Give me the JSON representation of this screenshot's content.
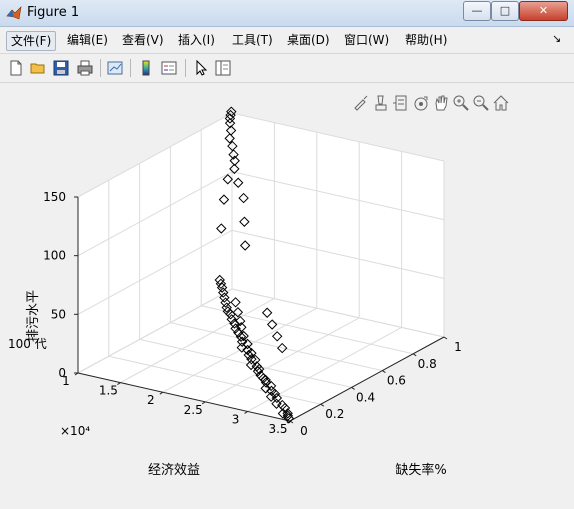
{
  "window": {
    "title": "Figure 1",
    "min_glyph": "—",
    "max_glyph": "□",
    "close_glyph": "✕"
  },
  "menu": {
    "items": [
      "文件(F)",
      "编辑(E)",
      "查看(V)",
      "插入(I)",
      "工具(T)",
      "桌面(D)",
      "窗口(W)",
      "帮助(H)"
    ],
    "corner_glyph": "↘"
  },
  "toolbar": {
    "icons": [
      "new-figure-icon",
      "open-file-icon",
      "save-icon",
      "print-icon",
      "link-plot-icon",
      "insert-colorbar-icon",
      "insert-legend-icon",
      "select-arrow-icon",
      "property-inspector-icon"
    ]
  },
  "axes_toolbar": {
    "icons": [
      "brush-icon",
      "data-tips-icon",
      "data-cursor-icon",
      "rotate-icon",
      "pan-icon",
      "zoom-in-icon",
      "zoom-out-icon",
      "home-icon"
    ]
  },
  "chart_data": {
    "type": "scatter3d",
    "marker": "diamond",
    "marker_color": "#000000",
    "xlabel": "经济效益",
    "ylabel": "缺失率%",
    "zlabel": "排污水平",
    "x_exponent_label": "×10⁴",
    "annotation": "100 代",
    "xlim": [
      1,
      3.5
    ],
    "ylim": [
      0,
      1
    ],
    "zlim": [
      0,
      150
    ],
    "x_ticks": [
      "1",
      "1.5",
      "2",
      "2.5",
      "3",
      "3.5"
    ],
    "y_ticks": [
      "0",
      "0.2",
      "0.4",
      "0.6",
      "0.8",
      "1"
    ],
    "z_ticks": [
      "0",
      "50",
      "100",
      "150"
    ],
    "grid": true,
    "points": [
      [
        3.45,
        0.02,
        0
      ],
      [
        3.42,
        0.03,
        1
      ],
      [
        3.4,
        0.04,
        2
      ],
      [
        3.38,
        0.02,
        3
      ],
      [
        3.35,
        0.05,
        5
      ],
      [
        3.3,
        0.06,
        6
      ],
      [
        3.25,
        0.05,
        7
      ],
      [
        3.2,
        0.08,
        9
      ],
      [
        3.15,
        0.07,
        10
      ],
      [
        3.1,
        0.1,
        12
      ],
      [
        3.05,
        0.09,
        14
      ],
      [
        3.0,
        0.12,
        16
      ],
      [
        2.95,
        0.13,
        18
      ],
      [
        2.9,
        0.14,
        19
      ],
      [
        2.85,
        0.15,
        21
      ],
      [
        2.8,
        0.17,
        23
      ],
      [
        2.75,
        0.16,
        24
      ],
      [
        2.7,
        0.19,
        26
      ],
      [
        2.65,
        0.2,
        28
      ],
      [
        2.6,
        0.22,
        30
      ],
      [
        2.55,
        0.21,
        32
      ],
      [
        2.5,
        0.24,
        34
      ],
      [
        2.45,
        0.26,
        36
      ],
      [
        2.4,
        0.27,
        38
      ],
      [
        2.35,
        0.28,
        40
      ],
      [
        2.3,
        0.3,
        42
      ],
      [
        2.25,
        0.31,
        44
      ],
      [
        2.2,
        0.33,
        46
      ],
      [
        2.15,
        0.34,
        47
      ],
      [
        2.1,
        0.36,
        48
      ],
      [
        2.05,
        0.38,
        50
      ],
      [
        2.0,
        0.4,
        52
      ],
      [
        1.95,
        0.42,
        54
      ],
      [
        1.9,
        0.44,
        56
      ],
      [
        1.85,
        0.46,
        57
      ],
      [
        1.8,
        0.48,
        58
      ],
      [
        3.05,
        0.15,
        5
      ],
      [
        2.95,
        0.18,
        8
      ],
      [
        2.85,
        0.2,
        10
      ],
      [
        2.7,
        0.24,
        14
      ],
      [
        2.6,
        0.27,
        18
      ],
      [
        2.5,
        0.3,
        20
      ],
      [
        2.4,
        0.33,
        24
      ],
      [
        2.3,
        0.36,
        27
      ],
      [
        2.2,
        0.4,
        30
      ],
      [
        2.15,
        0.42,
        33
      ],
      [
        2.05,
        0.46,
        36
      ],
      [
        1.95,
        0.5,
        40
      ],
      [
        2.5,
        0.5,
        10
      ],
      [
        2.35,
        0.55,
        14
      ],
      [
        2.2,
        0.6,
        18
      ],
      [
        2.05,
        0.65,
        22
      ],
      [
        1.7,
        0.7,
        70
      ],
      [
        1.6,
        0.75,
        85
      ],
      [
        1.5,
        0.8,
        100
      ],
      [
        1.4,
        0.82,
        110
      ],
      [
        1.3,
        0.85,
        118
      ],
      [
        1.25,
        0.88,
        122
      ],
      [
        1.2,
        0.9,
        125
      ],
      [
        1.15,
        0.92,
        130
      ],
      [
        1.1,
        0.93,
        135
      ],
      [
        1.08,
        0.95,
        140
      ],
      [
        1.05,
        0.96,
        145
      ],
      [
        1.03,
        0.97,
        148
      ],
      [
        1.02,
        0.98,
        150
      ],
      [
        1.01,
        0.99,
        152
      ],
      [
        1.6,
        0.6,
        90
      ],
      [
        1.45,
        0.7,
        105
      ],
      [
        1.35,
        0.78,
        115
      ]
    ]
  }
}
